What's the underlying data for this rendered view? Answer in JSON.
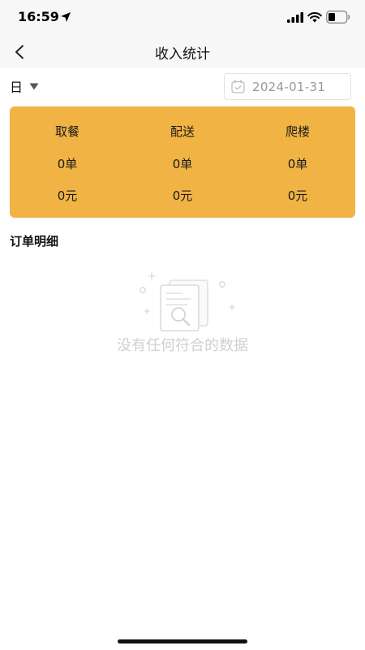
{
  "status_bar": {
    "time": "16:59"
  },
  "nav": {
    "title": "收入统计"
  },
  "filter": {
    "period": "日",
    "date": "2024-01-31"
  },
  "stats": [
    {
      "category": "取餐",
      "orders": "0单",
      "amount": "0元"
    },
    {
      "category": "配送",
      "orders": "0单",
      "amount": "0元"
    },
    {
      "category": "爬楼",
      "orders": "0单",
      "amount": "0元"
    }
  ],
  "section": {
    "title": "订单明细"
  },
  "empty": {
    "message": "没有任何符合的数据"
  },
  "colors": {
    "card": "#f1b344",
    "status_bar": "#f7f7f7"
  }
}
